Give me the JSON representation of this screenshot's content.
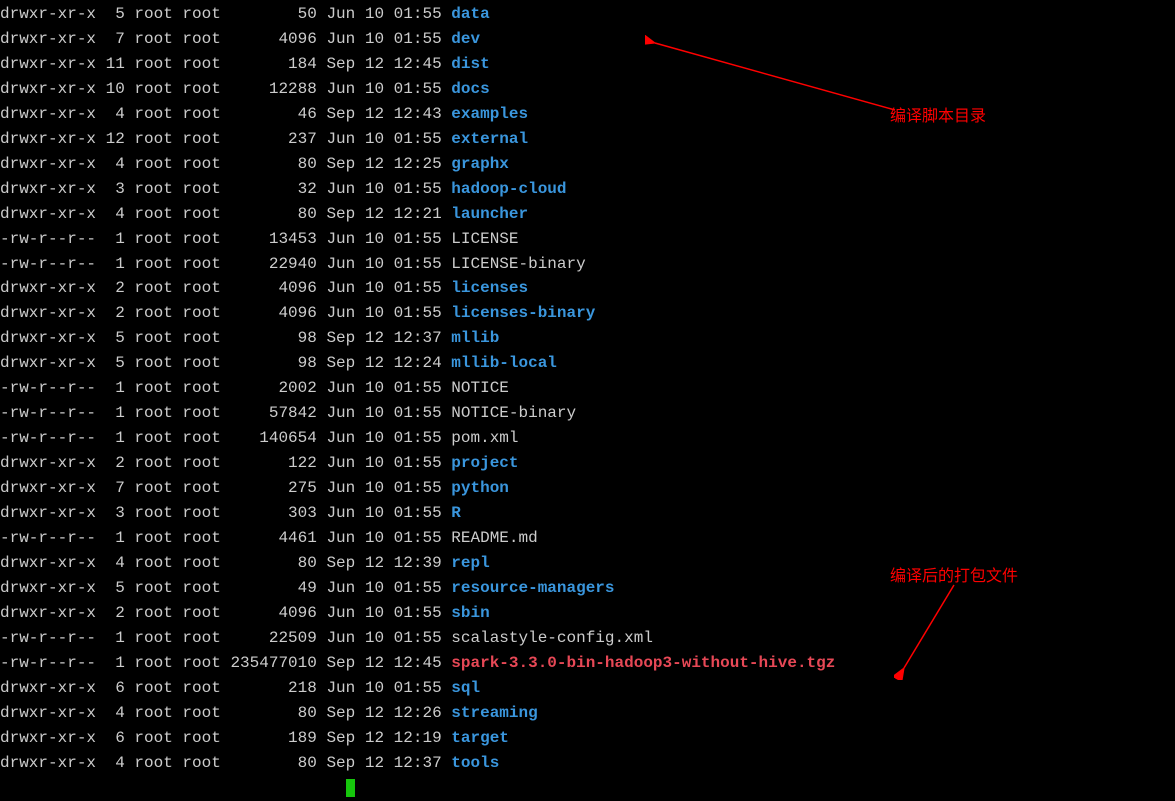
{
  "rows": [
    {
      "perm": "drwxr-xr-x",
      "links": "5",
      "owner": "root",
      "group": "root",
      "size": "50",
      "date": "Jun 10 01:55",
      "name": "data",
      "type": "dir"
    },
    {
      "perm": "drwxr-xr-x",
      "links": "7",
      "owner": "root",
      "group": "root",
      "size": "4096",
      "date": "Jun 10 01:55",
      "name": "dev",
      "type": "dir"
    },
    {
      "perm": "drwxr-xr-x",
      "links": "11",
      "owner": "root",
      "group": "root",
      "size": "184",
      "date": "Sep 12 12:45",
      "name": "dist",
      "type": "dir"
    },
    {
      "perm": "drwxr-xr-x",
      "links": "10",
      "owner": "root",
      "group": "root",
      "size": "12288",
      "date": "Jun 10 01:55",
      "name": "docs",
      "type": "dir"
    },
    {
      "perm": "drwxr-xr-x",
      "links": "4",
      "owner": "root",
      "group": "root",
      "size": "46",
      "date": "Sep 12 12:43",
      "name": "examples",
      "type": "dir"
    },
    {
      "perm": "drwxr-xr-x",
      "links": "12",
      "owner": "root",
      "group": "root",
      "size": "237",
      "date": "Jun 10 01:55",
      "name": "external",
      "type": "dir"
    },
    {
      "perm": "drwxr-xr-x",
      "links": "4",
      "owner": "root",
      "group": "root",
      "size": "80",
      "date": "Sep 12 12:25",
      "name": "graphx",
      "type": "dir"
    },
    {
      "perm": "drwxr-xr-x",
      "links": "3",
      "owner": "root",
      "group": "root",
      "size": "32",
      "date": "Jun 10 01:55",
      "name": "hadoop-cloud",
      "type": "dir"
    },
    {
      "perm": "drwxr-xr-x",
      "links": "4",
      "owner": "root",
      "group": "root",
      "size": "80",
      "date": "Sep 12 12:21",
      "name": "launcher",
      "type": "dir"
    },
    {
      "perm": "-rw-r--r--",
      "links": "1",
      "owner": "root",
      "group": "root",
      "size": "13453",
      "date": "Jun 10 01:55",
      "name": "LICENSE",
      "type": "file"
    },
    {
      "perm": "-rw-r--r--",
      "links": "1",
      "owner": "root",
      "group": "root",
      "size": "22940",
      "date": "Jun 10 01:55",
      "name": "LICENSE-binary",
      "type": "file"
    },
    {
      "perm": "drwxr-xr-x",
      "links": "2",
      "owner": "root",
      "group": "root",
      "size": "4096",
      "date": "Jun 10 01:55",
      "name": "licenses",
      "type": "dir"
    },
    {
      "perm": "drwxr-xr-x",
      "links": "2",
      "owner": "root",
      "group": "root",
      "size": "4096",
      "date": "Jun 10 01:55",
      "name": "licenses-binary",
      "type": "dir"
    },
    {
      "perm": "drwxr-xr-x",
      "links": "5",
      "owner": "root",
      "group": "root",
      "size": "98",
      "date": "Sep 12 12:37",
      "name": "mllib",
      "type": "dir"
    },
    {
      "perm": "drwxr-xr-x",
      "links": "5",
      "owner": "root",
      "group": "root",
      "size": "98",
      "date": "Sep 12 12:24",
      "name": "mllib-local",
      "type": "dir"
    },
    {
      "perm": "-rw-r--r--",
      "links": "1",
      "owner": "root",
      "group": "root",
      "size": "2002",
      "date": "Jun 10 01:55",
      "name": "NOTICE",
      "type": "file"
    },
    {
      "perm": "-rw-r--r--",
      "links": "1",
      "owner": "root",
      "group": "root",
      "size": "57842",
      "date": "Jun 10 01:55",
      "name": "NOTICE-binary",
      "type": "file"
    },
    {
      "perm": "-rw-r--r--",
      "links": "1",
      "owner": "root",
      "group": "root",
      "size": "140654",
      "date": "Jun 10 01:55",
      "name": "pom.xml",
      "type": "file"
    },
    {
      "perm": "drwxr-xr-x",
      "links": "2",
      "owner": "root",
      "group": "root",
      "size": "122",
      "date": "Jun 10 01:55",
      "name": "project",
      "type": "dir"
    },
    {
      "perm": "drwxr-xr-x",
      "links": "7",
      "owner": "root",
      "group": "root",
      "size": "275",
      "date": "Jun 10 01:55",
      "name": "python",
      "type": "dir"
    },
    {
      "perm": "drwxr-xr-x",
      "links": "3",
      "owner": "root",
      "group": "root",
      "size": "303",
      "date": "Jun 10 01:55",
      "name": "R",
      "type": "dir"
    },
    {
      "perm": "-rw-r--r--",
      "links": "1",
      "owner": "root",
      "group": "root",
      "size": "4461",
      "date": "Jun 10 01:55",
      "name": "README.md",
      "type": "file"
    },
    {
      "perm": "drwxr-xr-x",
      "links": "4",
      "owner": "root",
      "group": "root",
      "size": "80",
      "date": "Sep 12 12:39",
      "name": "repl",
      "type": "dir"
    },
    {
      "perm": "drwxr-xr-x",
      "links": "5",
      "owner": "root",
      "group": "root",
      "size": "49",
      "date": "Jun 10 01:55",
      "name": "resource-managers",
      "type": "dir"
    },
    {
      "perm": "drwxr-xr-x",
      "links": "2",
      "owner": "root",
      "group": "root",
      "size": "4096",
      "date": "Jun 10 01:55",
      "name": "sbin",
      "type": "dir"
    },
    {
      "perm": "-rw-r--r--",
      "links": "1",
      "owner": "root",
      "group": "root",
      "size": "22509",
      "date": "Jun 10 01:55",
      "name": "scalastyle-config.xml",
      "type": "file"
    },
    {
      "perm": "-rw-r--r--",
      "links": "1",
      "owner": "root",
      "group": "root",
      "size": "235477010",
      "date": "Sep 12 12:45",
      "name": "spark-3.3.0-bin-hadoop3-without-hive.tgz",
      "type": "tgz"
    },
    {
      "perm": "drwxr-xr-x",
      "links": "6",
      "owner": "root",
      "group": "root",
      "size": "218",
      "date": "Jun 10 01:55",
      "name": "sql",
      "type": "dir"
    },
    {
      "perm": "drwxr-xr-x",
      "links": "4",
      "owner": "root",
      "group": "root",
      "size": "80",
      "date": "Sep 12 12:26",
      "name": "streaming",
      "type": "dir"
    },
    {
      "perm": "drwxr-xr-x",
      "links": "6",
      "owner": "root",
      "group": "root",
      "size": "189",
      "date": "Sep 12 12:19",
      "name": "target",
      "type": "dir"
    },
    {
      "perm": "drwxr-xr-x",
      "links": "4",
      "owner": "root",
      "group": "root",
      "size": "80",
      "date": "Sep 12 12:37",
      "name": "tools",
      "type": "dir"
    }
  ],
  "annotations": {
    "a1": "编译脚本目录",
    "a2": "编译后的打包文件"
  }
}
